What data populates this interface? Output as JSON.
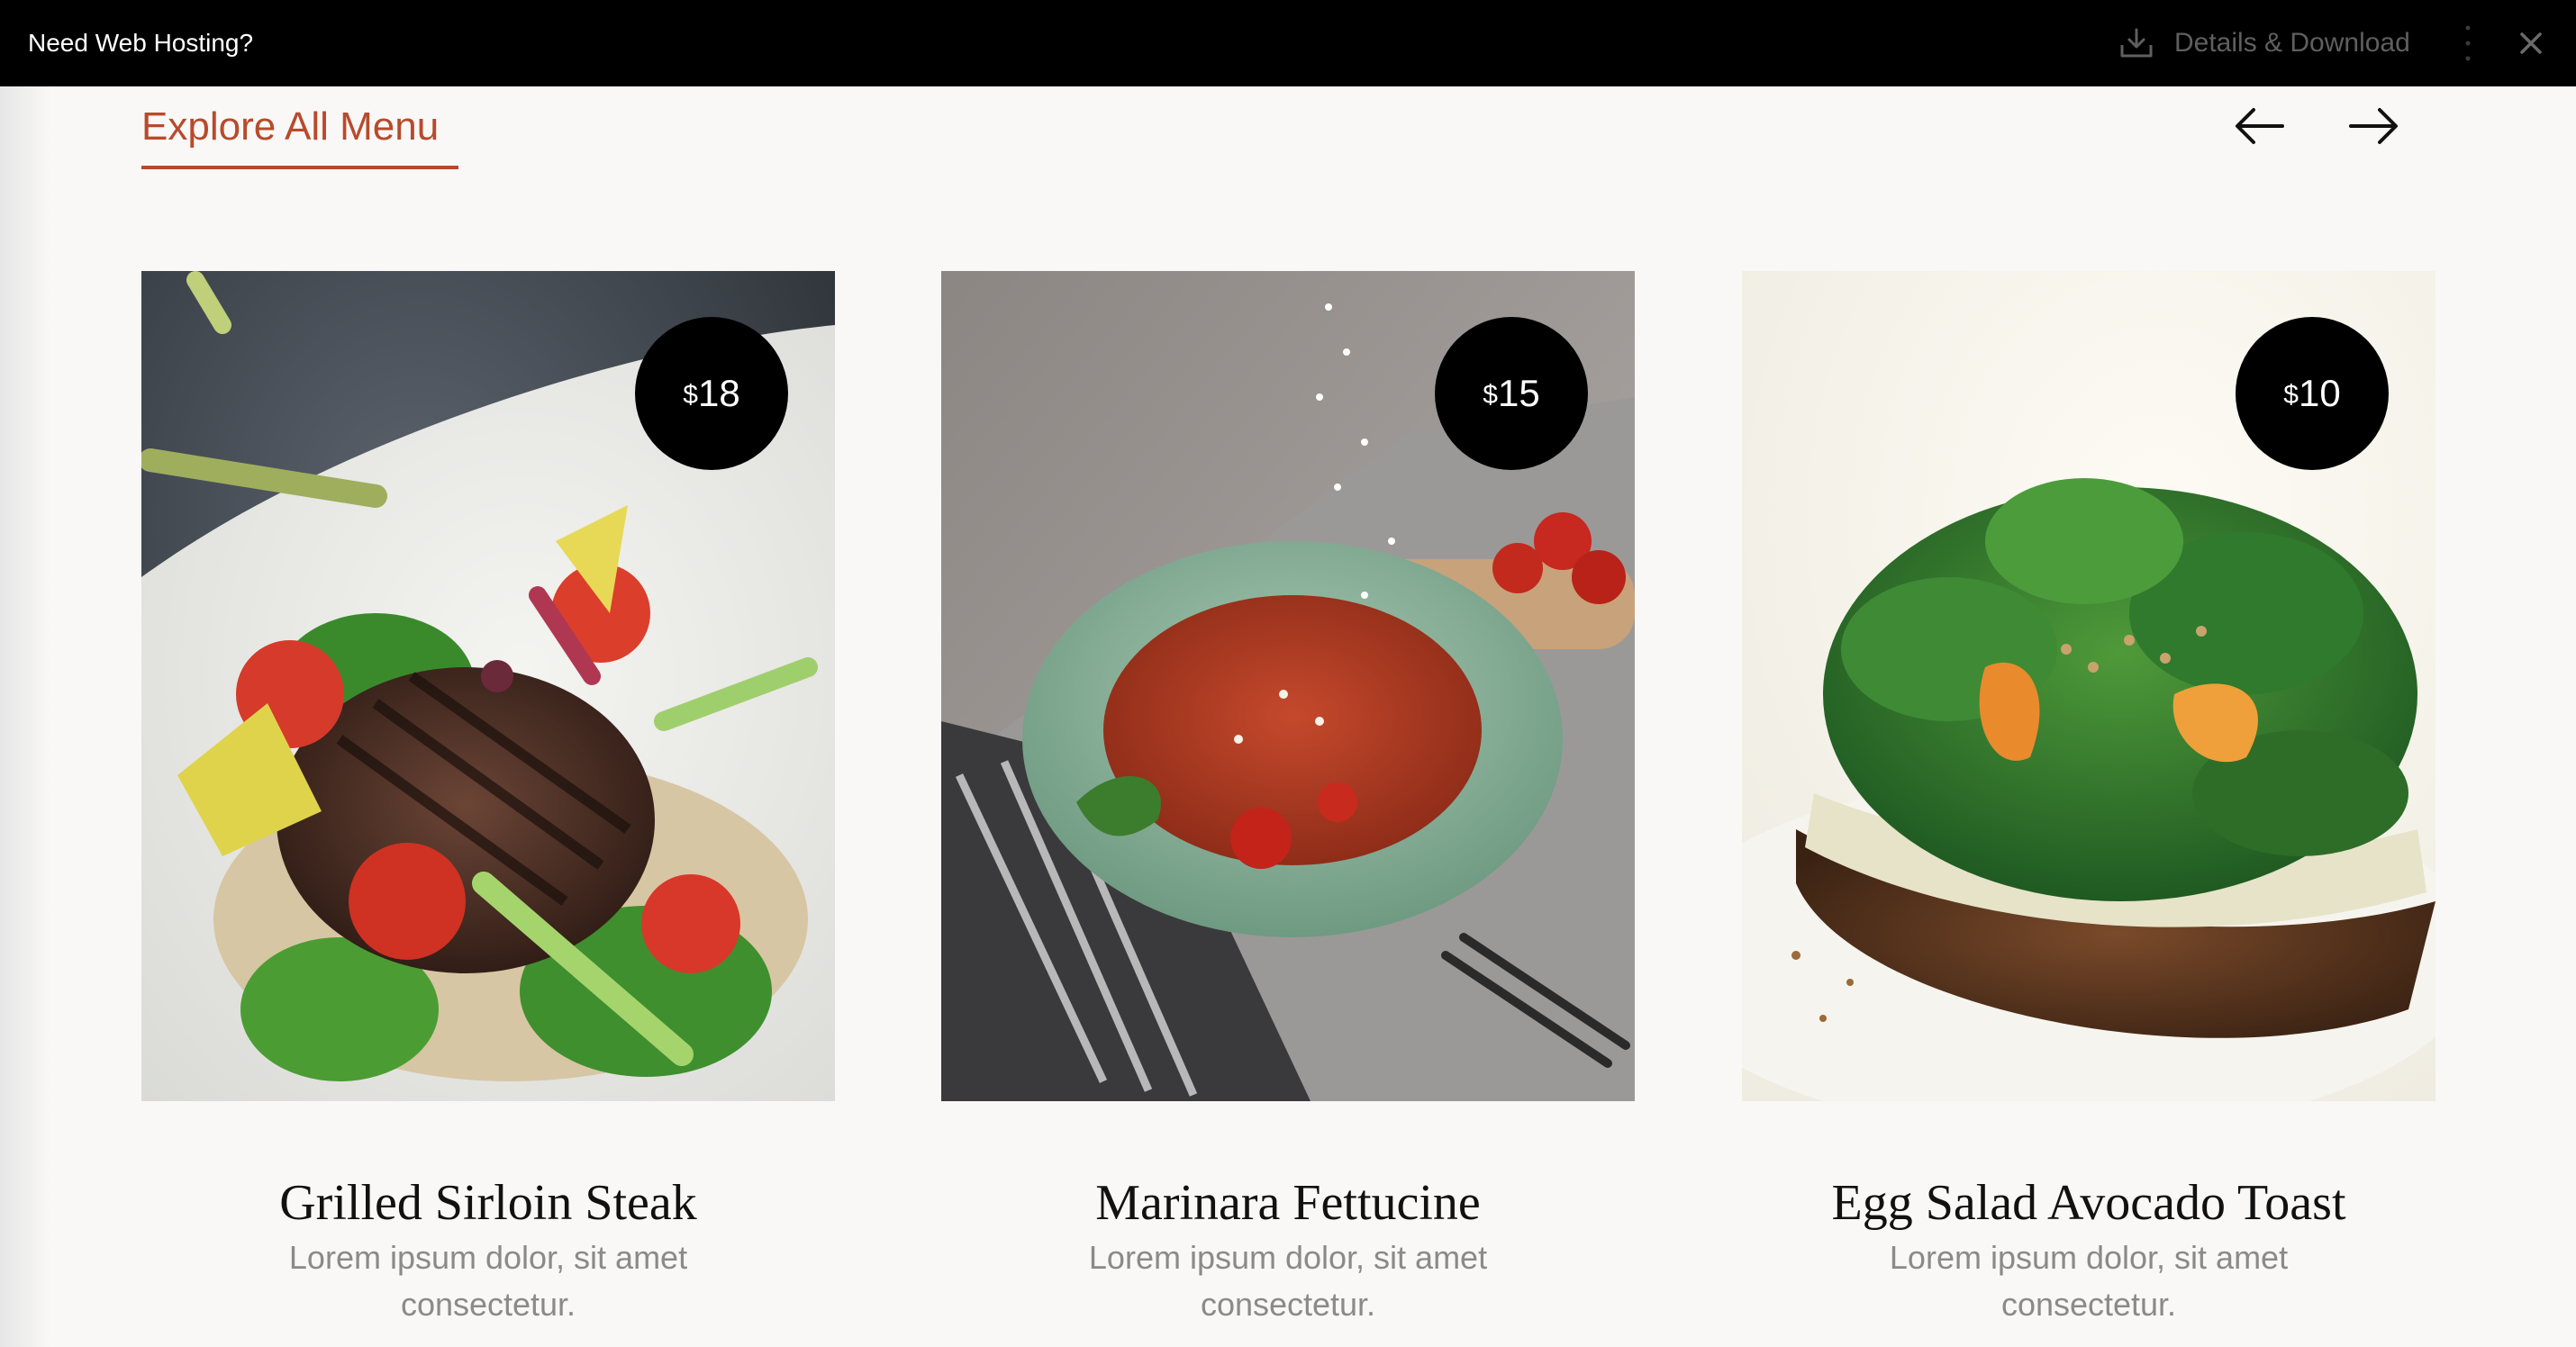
{
  "banner": {
    "title": "Need Web Hosting?",
    "download_label": "Details & Download",
    "icons": [
      "download-icon",
      "more-vertical-icon",
      "close-icon"
    ]
  },
  "section": {
    "title": "Explore All Menu",
    "accent_color": "#b84a2c",
    "nav_icons": [
      "arrow-left-icon",
      "arrow-right-icon"
    ]
  },
  "menu_items": [
    {
      "currency": "$",
      "price": "18",
      "name": "Grilled Sirloin Steak",
      "description": "Lorem ipsum dolor, sit amet consectetur."
    },
    {
      "currency": "$",
      "price": "15",
      "name": "Marinara Fettucine",
      "description": "Lorem ipsum dolor, sit amet consectetur."
    },
    {
      "currency": "$",
      "price": "10",
      "name": "Egg Salad Avocado Toast",
      "description": "Lorem ipsum dolor, sit amet consectetur."
    }
  ]
}
